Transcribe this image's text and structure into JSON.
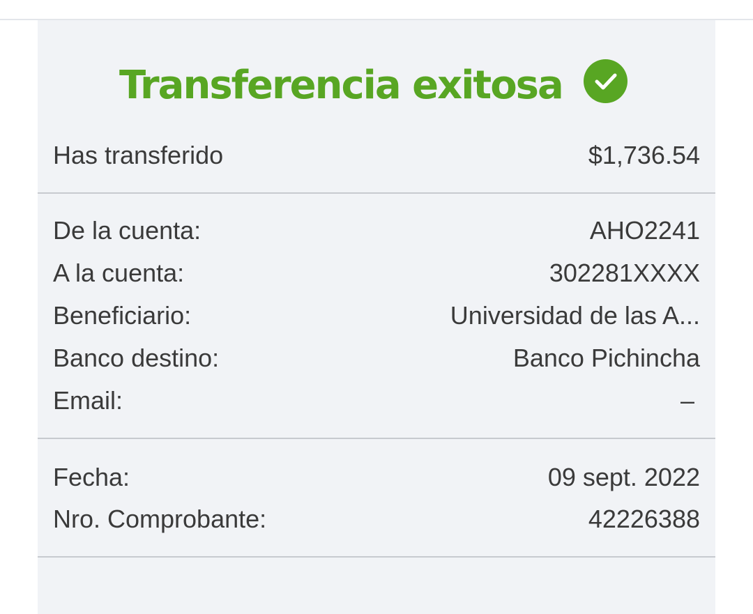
{
  "receipt": {
    "title": "Transferencia exitosa",
    "status_icon": "check-circle-icon",
    "accent_color": "#58a623",
    "amount": {
      "label": "Has transferido",
      "value": "$1,736.54"
    },
    "account_details": [
      {
        "label": "De la cuenta:",
        "value": "AHO2241"
      },
      {
        "label": "A la cuenta:",
        "value": "302281XXXX"
      },
      {
        "label": "Beneficiario:",
        "value": "Universidad de las A..."
      },
      {
        "label": "Banco destino:",
        "value": "Banco Pichincha"
      },
      {
        "label": "Email:",
        "value": "–"
      }
    ],
    "transaction_details": [
      {
        "label": "Fecha:",
        "value": "09 sept. 2022"
      },
      {
        "label": "Nro. Comprobante:",
        "value": "42226388"
      }
    ]
  }
}
